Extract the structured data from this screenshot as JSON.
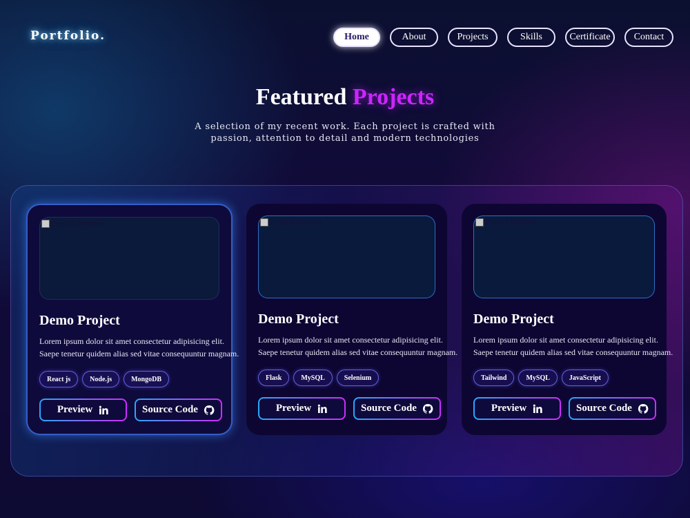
{
  "header": {
    "logo": "Portfolio.",
    "nav": [
      {
        "label": "Home",
        "active": true
      },
      {
        "label": "About"
      },
      {
        "label": "Projects"
      },
      {
        "label": "Skills"
      },
      {
        "label": "Certificate"
      },
      {
        "label": "Contact"
      }
    ]
  },
  "section": {
    "title_main": "Featured",
    "title_accent": "Projects",
    "subtitle": "A selection of my recent work. Each project is crafted with passion, attention to detail and modern technologies"
  },
  "projects": [
    {
      "image_alt": "Project Preview",
      "title": "Demo Project",
      "description": "Lorem ipsum dolor sit amet consectetur adipisicing elit. Saepe tenetur quidem alias sed vitae consequuntur magnam.",
      "tags": [
        "React js",
        "Node.js",
        "MongoDB"
      ],
      "preview_label": "Preview",
      "source_label": "Source Code"
    },
    {
      "image_alt": "Project Preview",
      "title": "Demo Project",
      "description": "Lorem ipsum dolor sit amet consectetur adipisicing elit. Saepe tenetur quidem alias sed vitae consequuntur magnam.",
      "tags": [
        "Flask",
        "MySQL",
        "Selenium"
      ],
      "preview_label": "Preview",
      "source_label": "Source Code"
    },
    {
      "image_alt": "Project Preview",
      "title": "Demo Project",
      "description": "Lorem ipsum dolor sit amet consectetur adipisicing elit. Saepe tenetur quidem alias sed vitae consequuntur magnam.",
      "tags": [
        "Tailwind",
        "MySQL",
        "JavaScript"
      ],
      "preview_label": "Preview",
      "source_label": "Source Code"
    }
  ],
  "icons": {
    "preview": "linkedin-icon",
    "source": "github-icon"
  },
  "colors": {
    "accent": "#cc25ff",
    "button_gradient_start": "#2aa8ff",
    "button_gradient_end": "#d02cff",
    "card_bg": "#0d0632"
  }
}
